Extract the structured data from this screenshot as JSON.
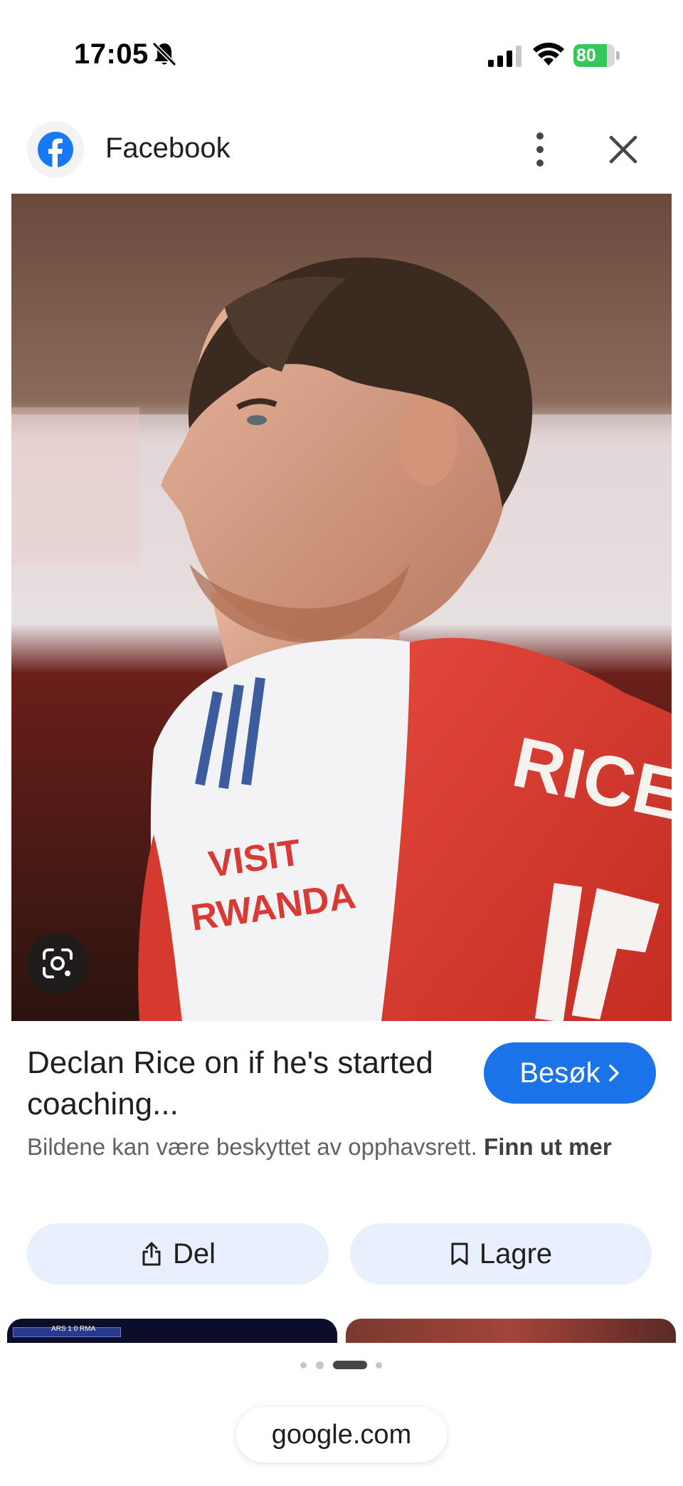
{
  "status_bar": {
    "time": "17:05",
    "battery": "80",
    "icons": [
      "bell-slash-icon",
      "signal-icon",
      "wifi-icon",
      "battery-icon"
    ]
  },
  "header": {
    "source": "Facebook",
    "logo_icon": "facebook-icon",
    "menu_icon": "more-vert-icon",
    "close_icon": "close-icon"
  },
  "image": {
    "jersey_name": "RICE",
    "sponsor_line1": "VISIT",
    "sponsor_line2": "RWANDA",
    "lens_icon": "google-lens-icon"
  },
  "result": {
    "title": "Declan Rice on if he's started coaching...",
    "visit_label": "Besøk",
    "visit_icon": "chevron-right-icon",
    "copyright_text": "Bildene kan være beskyttet av opphavsrett.",
    "learn_more": "Finn ut mer"
  },
  "actions": {
    "share_label": "Del",
    "share_icon": "share-icon",
    "save_label": "Lagre",
    "save_icon": "bookmark-icon"
  },
  "thumbnails": {
    "scoreboard": "ARS 1 0 RMA"
  },
  "bottom": {
    "url": "google.com",
    "pager_count": 4,
    "pager_active": 3
  },
  "colors": {
    "accent": "#1a73e8",
    "action_bg": "#e8f0fe",
    "battery": "#34c759",
    "facebook": "#1877f2"
  }
}
